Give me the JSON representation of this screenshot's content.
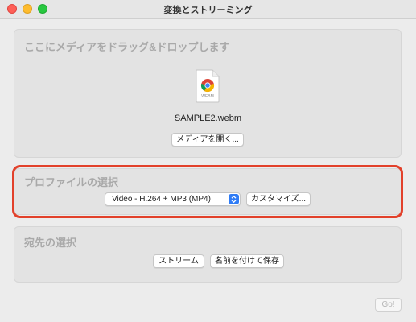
{
  "window": {
    "title": "変換とストリーミング"
  },
  "drop_area": {
    "hint": "ここにメディアをドラッグ&ドロップします",
    "file_icon": "webm-file-icon",
    "file_icon_caption": "WEBM",
    "file_name": "SAMPLE2.webm",
    "open_button": "メディアを開く..."
  },
  "profile": {
    "heading": "プロファイルの選択",
    "selected": "Video - H.264 + MP3 (MP4)",
    "customize_button": "カスタマイズ..."
  },
  "destination": {
    "heading": "宛先の選択",
    "stream_button": "ストリーム",
    "save_button": "名前を付けて保存"
  },
  "footer": {
    "go_button": "Go!"
  },
  "colors": {
    "highlight": "#e2412b",
    "select_accent": "#2f7cf6"
  }
}
